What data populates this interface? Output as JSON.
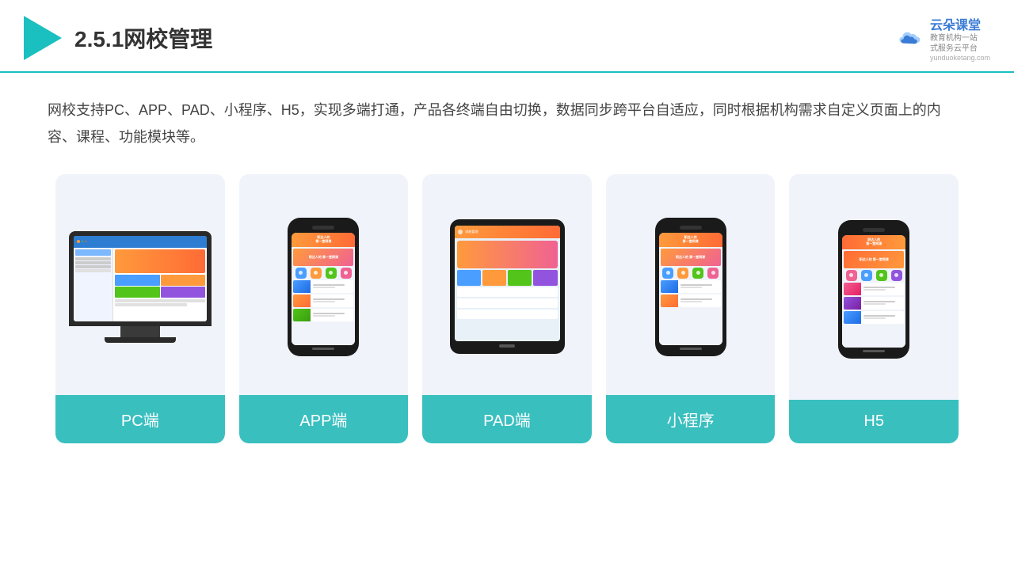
{
  "header": {
    "title": "2.5.1网校管理",
    "brand_name": "云朵课堂",
    "brand_url": "yunduoketang.com",
    "brand_tag_line1": "教育机构一站",
    "brand_tag_line2": "式服务云平台"
  },
  "description": {
    "text": "网校支持PC、APP、PAD、小程序、H5，实现多端打通，产品各终端自由切换，数据同步跨平台自适应，同时根据机构需求自定义页面上的内容、课程、功能模块等。"
  },
  "cards": [
    {
      "id": "pc",
      "label": "PC端"
    },
    {
      "id": "app",
      "label": "APP端"
    },
    {
      "id": "pad",
      "label": "PAD端"
    },
    {
      "id": "miniprogram",
      "label": "小程序"
    },
    {
      "id": "h5",
      "label": "H5"
    }
  ]
}
